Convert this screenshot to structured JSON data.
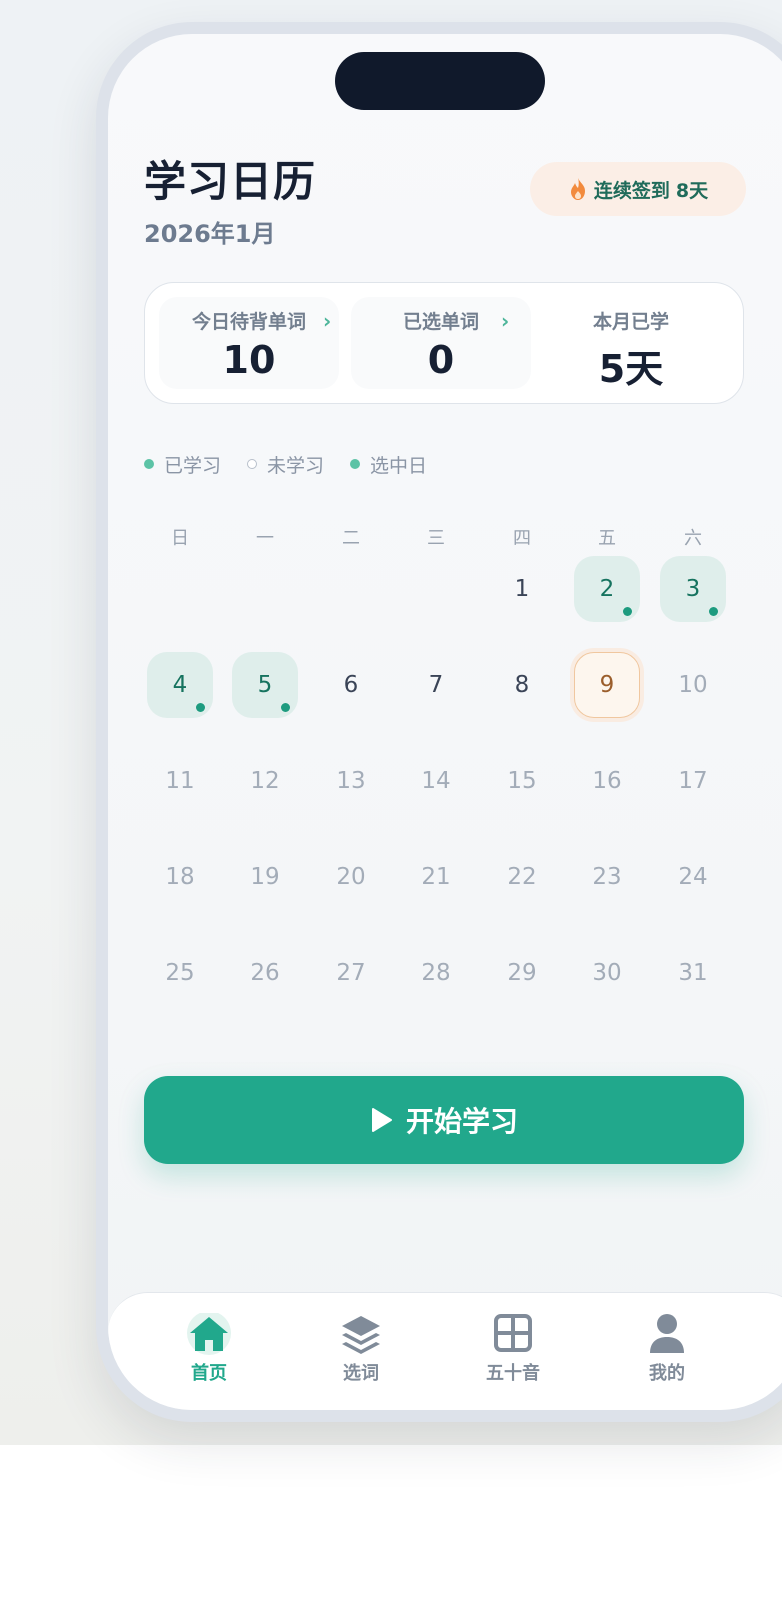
{
  "header": {
    "title": "学习日历",
    "month": "2026年1月",
    "streak_label": "连续签到",
    "streak_value": "8天"
  },
  "stats": [
    {
      "label": "今日待背单词",
      "value": "10",
      "has_chevron": true
    },
    {
      "label": "已选单词",
      "value": "0",
      "has_chevron": true
    },
    {
      "label": "本月已学",
      "value": "5天",
      "has_chevron": false
    }
  ],
  "legend": [
    {
      "label": "已学习",
      "marker": "filled-dot"
    },
    {
      "label": "未学习",
      "marker": "hollow-dot"
    },
    {
      "label": "选中日",
      "marker": "filled-dot"
    }
  ],
  "calendar": {
    "weekdays": [
      "日",
      "一",
      "二",
      "三",
      "四",
      "五",
      "六"
    ],
    "first_weekday_index": 4,
    "days_in_month": 31,
    "today": 9,
    "studied_days": [
      2,
      3,
      4,
      5
    ],
    "selected_day": 9
  },
  "start_button": {
    "label": "开始学习",
    "icon": "play-icon"
  },
  "tabbar": [
    {
      "label": "首页",
      "icon": "home-icon",
      "active": true
    },
    {
      "label": "选词",
      "icon": "layers-icon",
      "active": false
    },
    {
      "label": "五十音",
      "icon": "grid-icon",
      "active": false
    },
    {
      "label": "我的",
      "icon": "user-icon",
      "active": false
    }
  ],
  "colors": {
    "accent": "#21a88c",
    "studied_bg": "#dfeeeb",
    "selected_bg": "#fdf6ee",
    "streak_bg": "#fbeee6",
    "flame": "#f28a3d",
    "text_dark": "#172033"
  }
}
